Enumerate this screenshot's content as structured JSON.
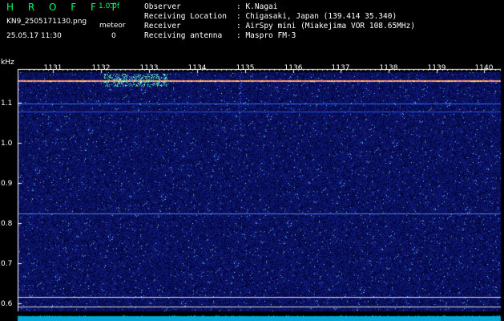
{
  "header": {
    "brand": "H R O F F T",
    "version": "1.0.0f",
    "file_name": "KN9_2505171130.png",
    "timestamp": "25.05.17 11:30",
    "meteor_label": "meteor",
    "meteor_count": "0",
    "info": [
      {
        "key": "Observer",
        "value": ": K.Nagai"
      },
      {
        "key": "Receiving Location",
        "value": ": Chigasaki, Japan (139.414 35.340)"
      },
      {
        "key": "Receiver",
        "value": ": AirSpy mini (Miakejima VOR 108.65MHz)"
      },
      {
        "key": "Receiving antenna",
        "value": ": Maspro FM-3"
      }
    ]
  },
  "spectrogram": {
    "y_unit": "kHz",
    "y_ticks": [
      "1.1",
      "1.0",
      "0.9",
      "0.8",
      "0.7",
      "0.6"
    ],
    "x_ticks": [
      "1131",
      "1132",
      "1133",
      "1134",
      "1135",
      "1136",
      "1137",
      "1138",
      "1139",
      "1140"
    ],
    "colors": {
      "background": "#000000",
      "noise": "#0b1a8c",
      "carrier": "#ffaa33",
      "axis": "#ffffff",
      "trace": "#00d8ff"
    }
  }
}
